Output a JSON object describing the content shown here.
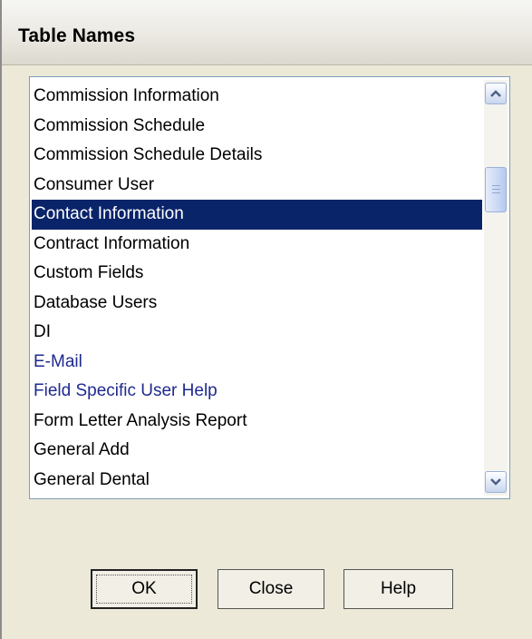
{
  "dialog": {
    "title": "Table Names"
  },
  "list": {
    "items": [
      {
        "label": "Commission Information",
        "state": "normal"
      },
      {
        "label": "Commission Schedule",
        "state": "normal"
      },
      {
        "label": "Commission Schedule Details",
        "state": "normal"
      },
      {
        "label": "Consumer User",
        "state": "normal"
      },
      {
        "label": "Contact Information",
        "state": "selected"
      },
      {
        "label": "Contract Information",
        "state": "normal"
      },
      {
        "label": "Custom Fields",
        "state": "normal"
      },
      {
        "label": "Database Users",
        "state": "normal"
      },
      {
        "label": "DI",
        "state": "normal"
      },
      {
        "label": "E-Mail",
        "state": "linked"
      },
      {
        "label": "Field Specific User Help",
        "state": "linked"
      },
      {
        "label": "Form Letter Analysis Report",
        "state": "normal"
      },
      {
        "label": "General Add",
        "state": "normal"
      },
      {
        "label": "General Dental",
        "state": "normal"
      }
    ],
    "selected_index": 4
  },
  "scrollbar": {
    "up_icon": "chevron-up-icon",
    "down_icon": "chevron-down-icon",
    "thumb_icon": "grip-icon"
  },
  "buttons": {
    "ok_label": "OK",
    "close_label": "Close",
    "help_label": "Help"
  },
  "colors": {
    "selection_background": "#0a246a",
    "selection_text": "#ffffff",
    "linked_text": "#1f2a8f",
    "dialog_background": "#ece9d8"
  }
}
